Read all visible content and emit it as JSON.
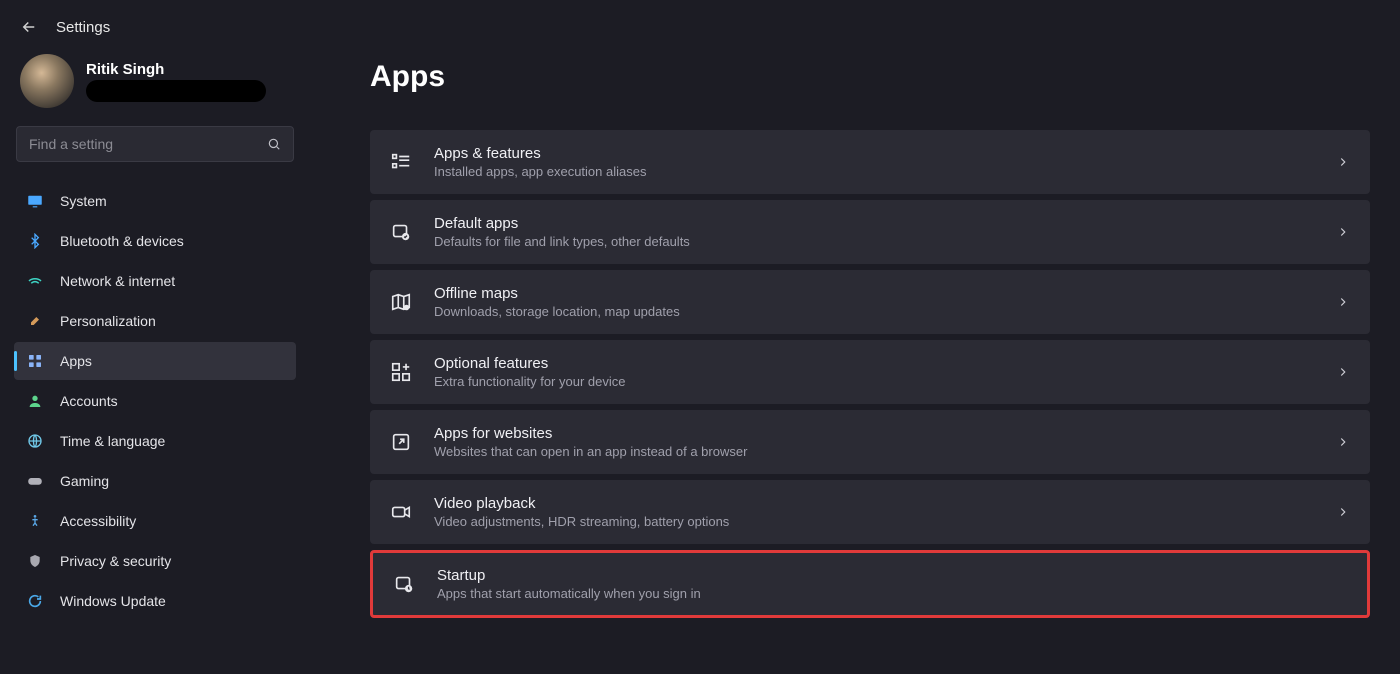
{
  "header": {
    "title": "Settings"
  },
  "profile": {
    "name": "Ritik Singh"
  },
  "search": {
    "placeholder": "Find a setting"
  },
  "nav": {
    "items": [
      {
        "label": "System"
      },
      {
        "label": "Bluetooth & devices"
      },
      {
        "label": "Network & internet"
      },
      {
        "label": "Personalization"
      },
      {
        "label": "Apps"
      },
      {
        "label": "Accounts"
      },
      {
        "label": "Time & language"
      },
      {
        "label": "Gaming"
      },
      {
        "label": "Accessibility"
      },
      {
        "label": "Privacy & security"
      },
      {
        "label": "Windows Update"
      }
    ]
  },
  "page": {
    "title": "Apps"
  },
  "cards": [
    {
      "title": "Apps & features",
      "desc": "Installed apps, app execution aliases"
    },
    {
      "title": "Default apps",
      "desc": "Defaults for file and link types, other defaults"
    },
    {
      "title": "Offline maps",
      "desc": "Downloads, storage location, map updates"
    },
    {
      "title": "Optional features",
      "desc": "Extra functionality for your device"
    },
    {
      "title": "Apps for websites",
      "desc": "Websites that can open in an app instead of a browser"
    },
    {
      "title": "Video playback",
      "desc": "Video adjustments, HDR streaming, battery options"
    },
    {
      "title": "Startup",
      "desc": "Apps that start automatically when you sign in"
    }
  ]
}
